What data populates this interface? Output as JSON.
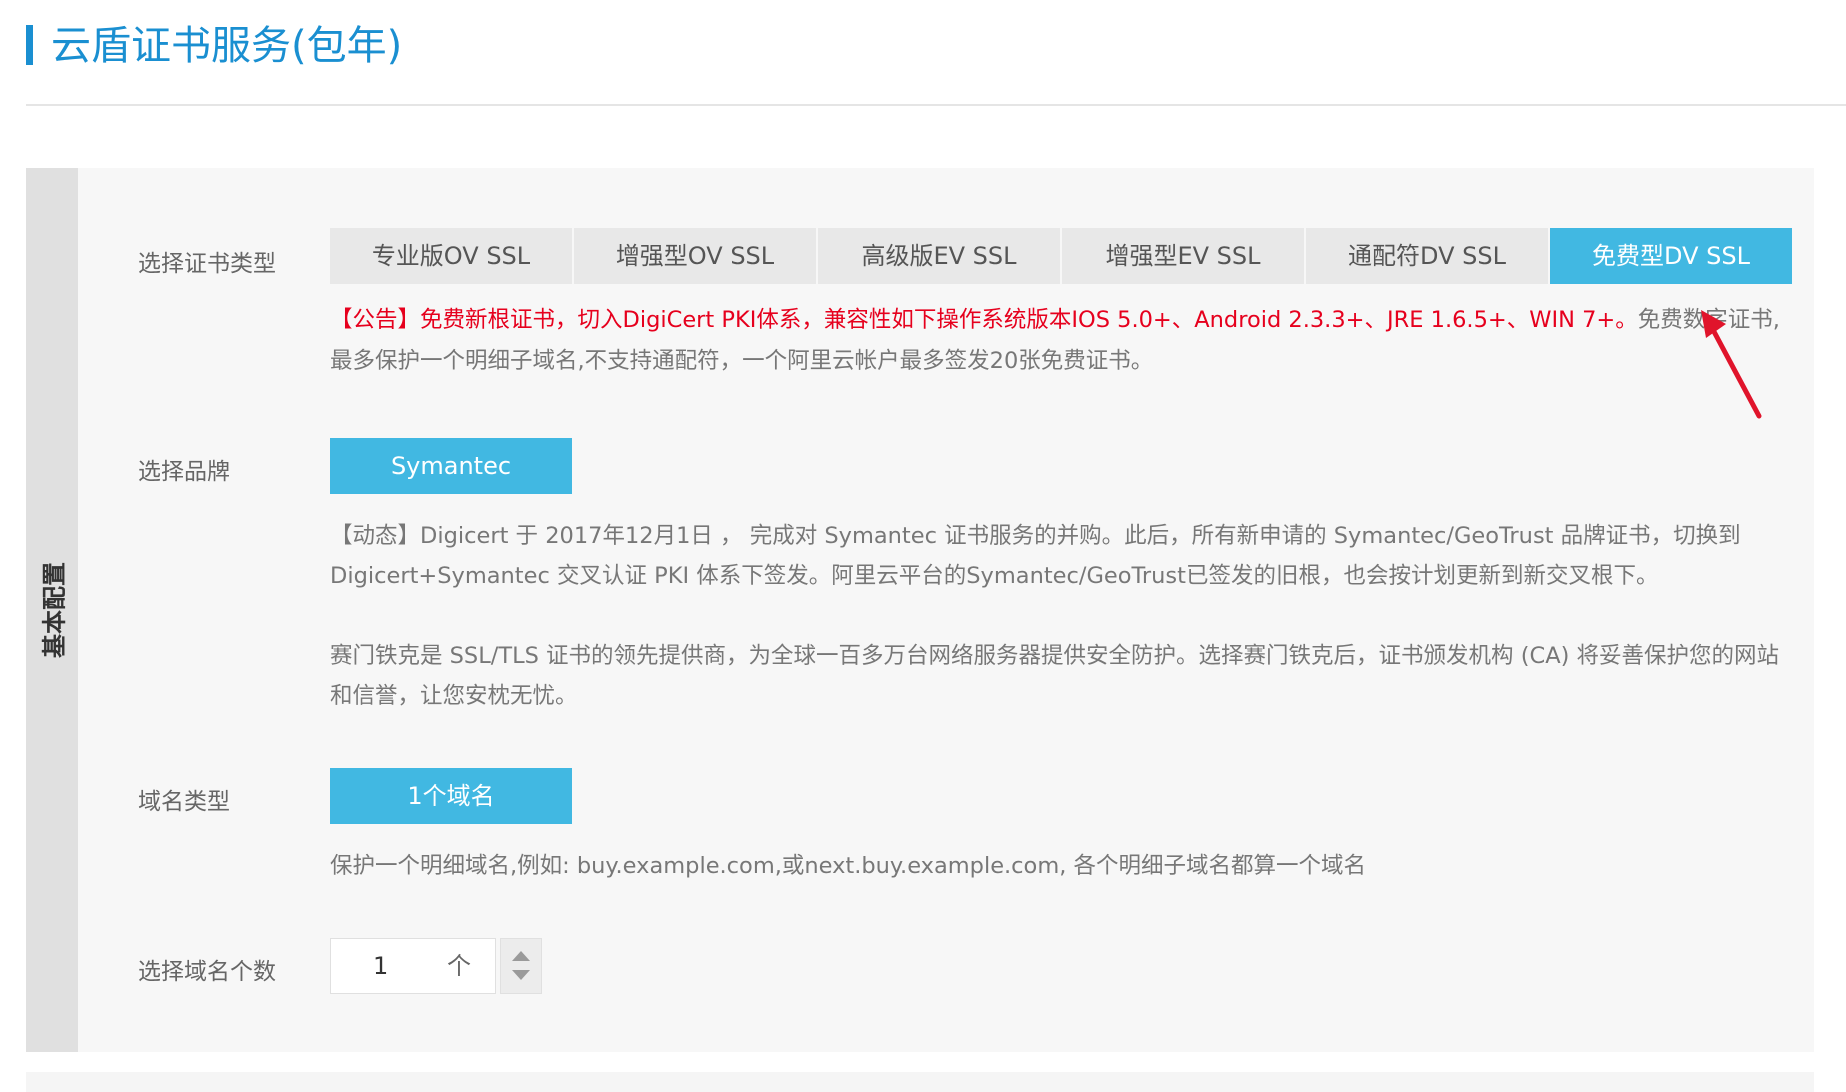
{
  "page": {
    "title": "云盾证书服务(包年)"
  },
  "panel": {
    "side_label": "基本配置"
  },
  "cert_type": {
    "label": "选择证书类型",
    "tabs": [
      {
        "label": "专业版OV SSL",
        "active": false
      },
      {
        "label": "增强型OV SSL",
        "active": false
      },
      {
        "label": "高级版EV SSL",
        "active": false
      },
      {
        "label": "增强型EV SSL",
        "active": false
      },
      {
        "label": "通配符DV SSL",
        "active": false
      },
      {
        "label": "免费型DV SSL",
        "active": true
      }
    ],
    "notice_red": "【公告】免费新根证书，切入DigiCert PKI体系，兼容性如下操作系统版本IOS 5.0+、Android 2.3.3+、JRE 1.6.5+、WIN 7+。",
    "notice_gray": "免费数字证书,最多保护一个明细子域名,不支持通配符，一个阿里云帐户最多签发20张免费证书。"
  },
  "brand": {
    "label": "选择品牌",
    "selected": "Symantec",
    "desc_1": "【动态】Digicert 于 2017年12月1日 ， 完成对 Symantec 证书服务的并购。此后，所有新申请的 Symantec/GeoTrust 品牌证书，切换到 Digicert+Symantec 交叉认证 PKI 体系下签发。阿里云平台的Symantec/GeoTrust已签发的旧根，也会按计划更新到新交叉根下。",
    "desc_2": "赛门铁克是 SSL/TLS 证书的领先提供商，为全球一百多万台网络服务器提供安全防护。选择赛门铁克后，证书颁发机构 (CA) 将妥善保护您的网站和信誉，让您安枕无忧。"
  },
  "domain_type": {
    "label": "域名类型",
    "selected": "1个域名",
    "desc": "保护一个明细域名,例如: buy.example.com,或next.buy.example.com, 各个明细子域名都算一个域名"
  },
  "domain_count": {
    "label": "选择域名个数",
    "value": "1",
    "unit": "个"
  },
  "colors": {
    "accent": "#41b8e2",
    "title": "#1a8fd1",
    "notice_red": "#e6001d",
    "annotation_arrow": "#e0142b"
  },
  "icons": {
    "stepper_up": "arrow-up-icon",
    "stepper_down": "arrow-down-icon",
    "annotation": "red-arrow-icon"
  }
}
